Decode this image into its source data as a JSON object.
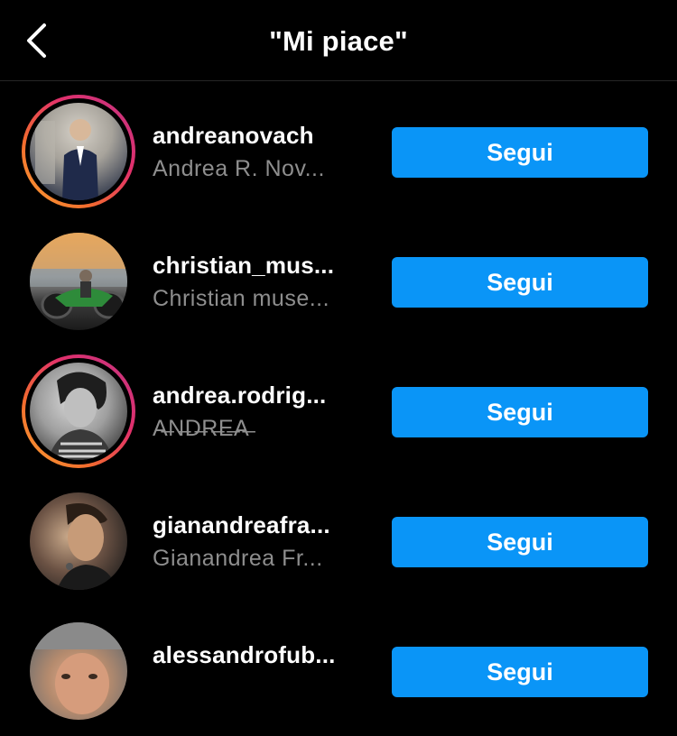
{
  "header": {
    "title": "\"Mi piace\"",
    "back_icon": "chevron-left-icon"
  },
  "colors": {
    "background": "#000000",
    "follow_button": "#0a95f7",
    "secondary_text": "#8e8e8e",
    "story_ring": [
      "#f9a533",
      "#e1306c",
      "#c13584"
    ]
  },
  "likes": [
    {
      "username": "andreanovach",
      "full_name": "Andrea R. Nov...",
      "has_story": true,
      "button_label": "Segui"
    },
    {
      "username": "christian_mus...",
      "full_name": "Christian muse...",
      "has_story": false,
      "button_label": "Segui"
    },
    {
      "username": "andrea.rodrig...",
      "full_name": "A̶N̶D̶R̶E̶A̶",
      "has_story": true,
      "button_label": "Segui"
    },
    {
      "username": "gianandreafra...",
      "full_name": "Gianandrea Fr...",
      "has_story": false,
      "button_label": "Segui"
    },
    {
      "username": "alessandrofub...",
      "full_name": "",
      "has_story": false,
      "button_label": "Segui"
    }
  ]
}
